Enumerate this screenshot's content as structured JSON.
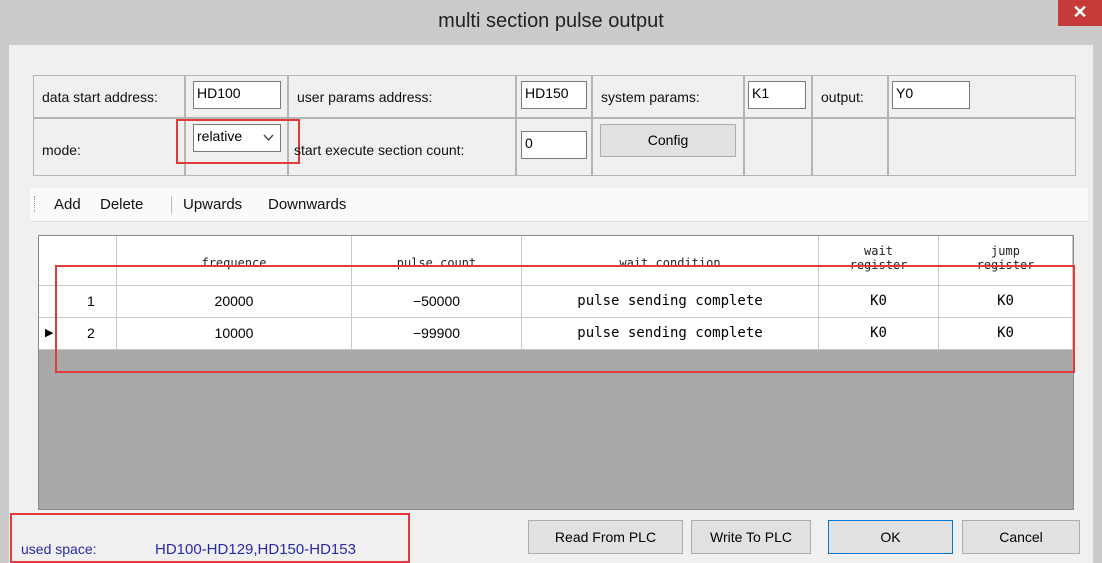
{
  "window": {
    "title": "multi section pulse output",
    "close_glyph": "✕"
  },
  "params": {
    "data_start_label": "data start address:",
    "data_start_value": "HD100",
    "user_params_label": "user params address:",
    "user_params_value": "HD150",
    "system_params_label": "system params:",
    "system_params_value": "K1",
    "output_label": "output:",
    "output_value": "Y0",
    "mode_label": "mode:",
    "mode_value": "relative",
    "start_exec_label": "start execute section count:",
    "start_exec_value": "0",
    "config_button": "Config"
  },
  "toolbar": {
    "add": "Add",
    "delete": "Delete",
    "upwards": "Upwards",
    "downwards": "Downwards"
  },
  "grid": {
    "headers": [
      "frequence",
      "pulse count",
      "wait condition",
      "wait\nregister",
      "jump\nregister"
    ],
    "rows": [
      {
        "index": "1",
        "frequence": "20000",
        "pulse_count": "−50000",
        "wait_condition": "pulse sending complete",
        "wait_register": "K0",
        "jump_register": "K0"
      },
      {
        "index": "2",
        "frequence": "10000",
        "pulse_count": "−99900",
        "wait_condition": "pulse sending complete",
        "wait_register": "K0",
        "jump_register": "K0"
      }
    ],
    "current_row_marker": "▶"
  },
  "footer": {
    "used_space_label": "used space:",
    "used_space_value": "HD100-HD129,HD150-HD153",
    "read_button": "Read From PLC",
    "write_button": "Write To PLC",
    "ok_button": "OK",
    "cancel_button": "Cancel"
  }
}
